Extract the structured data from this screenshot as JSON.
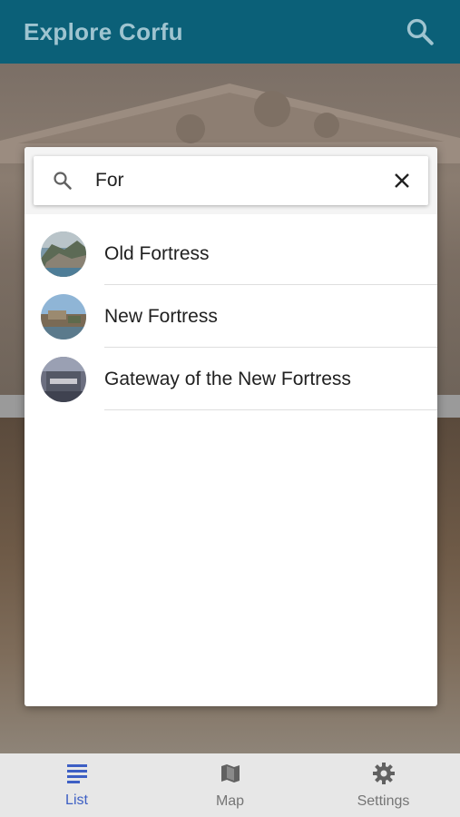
{
  "app": {
    "title": "Explore Corfu",
    "accent": "#0b6078",
    "search_icon": "search-icon"
  },
  "search_dialog": {
    "query": "For",
    "search_icon": "search-icon",
    "clear_icon": "close-icon",
    "results": [
      {
        "label": "Old Fortress",
        "thumbnail": "old-fortress-thumbnail"
      },
      {
        "label": "New Fortress",
        "thumbnail": "new-fortress-thumbnail"
      },
      {
        "label": "Gateway of the New Fortress",
        "thumbnail": "gateway-new-fortress-thumbnail"
      }
    ]
  },
  "bottom_nav": {
    "items": [
      {
        "label": "List",
        "icon": "list-icon",
        "active": true
      },
      {
        "label": "Map",
        "icon": "map-icon",
        "active": false
      },
      {
        "label": "Settings",
        "icon": "gear-icon",
        "active": false
      }
    ],
    "active_color": "#3d5fc4"
  }
}
